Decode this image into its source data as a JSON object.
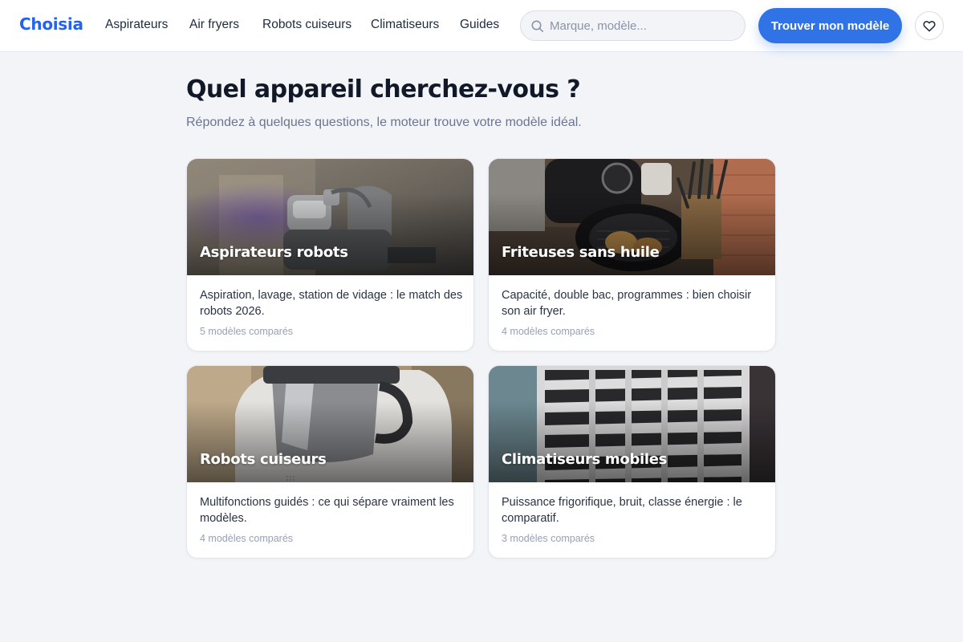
{
  "header": {
    "logo": "Choisia",
    "nav": [
      "Aspirateurs",
      "Air fryers",
      "Robots cuiseurs",
      "Climatiseurs",
      "Guides"
    ],
    "search_placeholder": "Marque, modèle...",
    "cta_label": "Trouver mon modèle",
    "icons": {
      "search": "search-icon",
      "favorites": "heart-icon"
    }
  },
  "main": {
    "title": "Quel appareil cherchez-vous ?",
    "subtitle": "Répondez à quelques questions, le moteur trouve votre modèle idéal."
  },
  "categories": [
    {
      "title": "Aspirateurs robots",
      "description": "Aspiration, lavage, station de vidage : le match des robots 2026.",
      "count": "5 modèles comparés"
    },
    {
      "title": "Friteuses sans huile",
      "description": "Capacité, double bac, programmes : bien choisir son air fryer.",
      "count": "4 modèles comparés"
    },
    {
      "title": "Robots cuiseurs",
      "description": "Multifonctions guidés : ce qui sépare vraiment les modèles.",
      "count": "4 modèles comparés"
    },
    {
      "title": "Climatiseurs mobiles",
      "description": "Puissance frigorifique, bruit, classe énergie : le comparatif.",
      "count": "3 modèles comparés"
    }
  ],
  "colors": {
    "brand": "#2563eb",
    "cta": "#2f73e6",
    "background": "#f3f4f8",
    "muted_text": "#6b7590"
  }
}
